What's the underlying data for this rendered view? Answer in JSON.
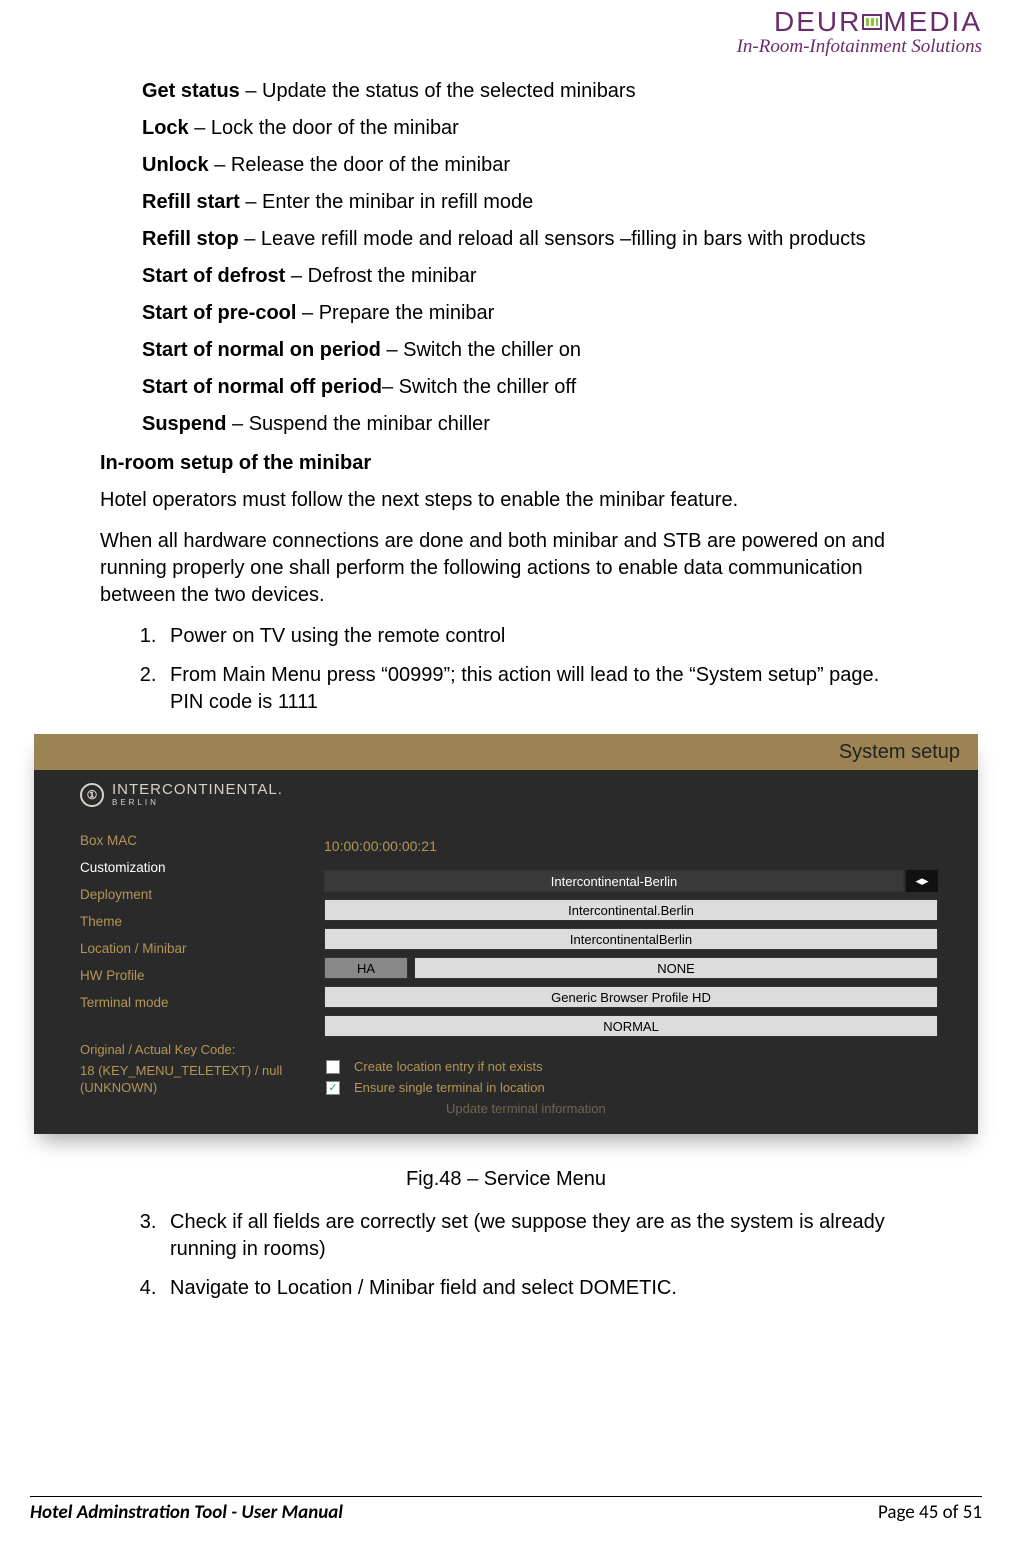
{
  "logo": {
    "brand_pre": "DEUR",
    "brand_post": "MEDIA",
    "tagline": "In-Room-Infotainment Solutions"
  },
  "commands": [
    {
      "label": "Get status",
      "desc": " – Update the status of the selected minibars"
    },
    {
      "label": "Lock",
      "desc": " – Lock the door of the minibar"
    },
    {
      "label": "Unlock",
      "desc": " – Release the door of the minibar"
    },
    {
      "label": "Refill start",
      "desc": " – Enter the minibar in refill mode"
    },
    {
      "label": "Refill stop",
      "desc": " – Leave refill mode and reload all sensors –filling in bars with products"
    },
    {
      "label": "Start of defrost",
      "desc": " – Defrost the minibar"
    },
    {
      "label": "Start of pre-cool",
      "desc": " – Prepare the minibar"
    },
    {
      "label": "Start of normal on period",
      "desc": " – Switch the chiller on"
    },
    {
      "label": "Start of normal off period",
      "desc": "– Switch the chiller off"
    },
    {
      "label": "Suspend",
      "desc": " – Suspend the minibar chiller"
    }
  ],
  "section_heading": "In-room setup of the minibar",
  "para1": "Hotel operators must follow the next steps to enable the minibar feature.",
  "para2": "When all hardware connections are done and both minibar and STB are powered on and running properly one shall perform the following actions to enable data communication between the two devices.",
  "steps_a": [
    "Power on TV using the remote control",
    "From Main Menu press “00999”; this action will lead to the “System setup” page. PIN code is 1111"
  ],
  "screenshot": {
    "title": "System setup",
    "hotel_logo": {
      "main": "INTERCONTINENTAL.",
      "sub": "BERLIN"
    },
    "menu": [
      "Box MAC",
      "Customization",
      "Deployment",
      "Theme",
      "Location / Minibar",
      "HW Profile",
      "Terminal mode"
    ],
    "keycode_label": "Original / Actual Key Code:",
    "keycode_value": "18 (KEY_MENU_TELETEXT) / null (UNKNOWN)",
    "mac": "10:00:00:00:00:21",
    "fields": {
      "customization": "Intercontinental-Berlin",
      "deployment": "Intercontinental.Berlin",
      "theme": "IntercontinentalBerlin",
      "loc_short": "HA",
      "loc_val": "NONE",
      "hw": "Generic Browser Profile HD",
      "term": "NORMAL"
    },
    "checks": {
      "c1": "Create location entry if not exists",
      "c2": "Ensure single terminal in location",
      "c3": "Update terminal information"
    }
  },
  "caption": "Fig.48 – Service Menu",
  "steps_b": [
    "Check if all fields are correctly set (we suppose they are as the system is already running in rooms)",
    "Navigate to Location / Minibar field and select DOMETIC."
  ],
  "footer": {
    "left": "Hotel Adminstration Tool - User Manual",
    "right": "Page 45 of 51"
  }
}
